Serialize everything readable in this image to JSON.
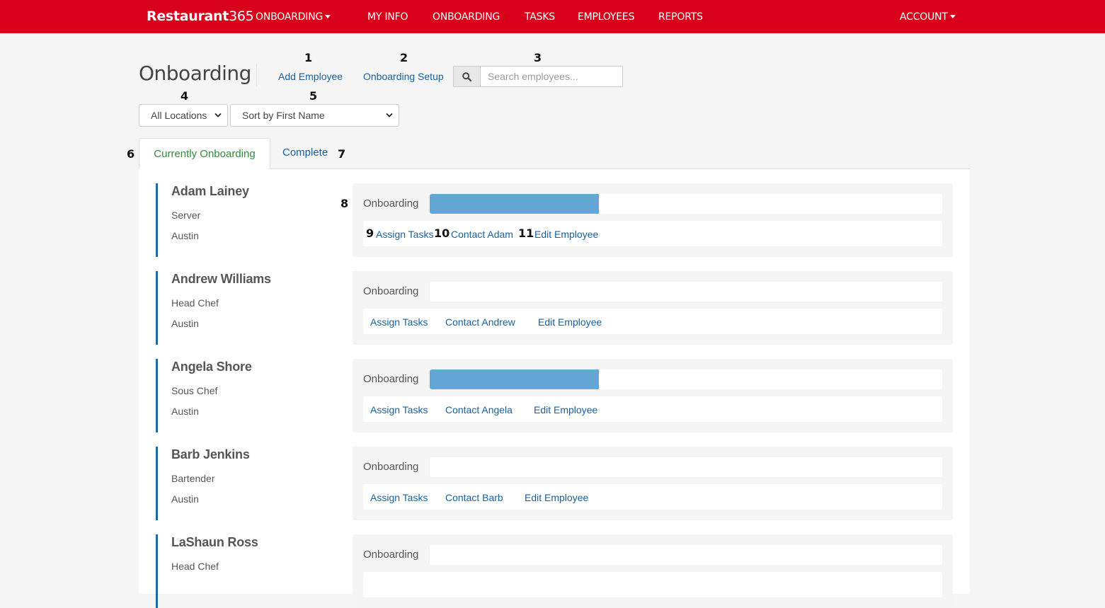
{
  "nav": {
    "brand_bold": "Restaurant",
    "brand_thin": "365",
    "module_menu": "ONBOARDING",
    "links": [
      "MY INFO",
      "ONBOARDING",
      "TASKS",
      "EMPLOYEES",
      "REPORTS"
    ],
    "account": "ACCOUNT"
  },
  "header": {
    "title": "Onboarding",
    "add_employee": "Add Employee",
    "onboarding_setup": "Onboarding Setup",
    "search_placeholder": "Search employees..."
  },
  "filters": {
    "location": "All Locations",
    "sort": "Sort by First Name"
  },
  "tabs": {
    "active": "Currently Onboarding",
    "other": "Complete"
  },
  "callouts": [
    "1",
    "2",
    "3",
    "4",
    "5",
    "6",
    "7",
    "8",
    "9",
    "10",
    "11"
  ],
  "progress_label": "Onboarding",
  "employees": [
    {
      "name": "Adam Lainey",
      "role": "Server",
      "location": "Austin",
      "progress": 0.33,
      "assign": "Assign Tasks",
      "contact": "Contact Adam",
      "edit": "Edit Employee"
    },
    {
      "name": "Andrew Williams",
      "role": "Head Chef",
      "location": "Austin",
      "progress": 0,
      "assign": "Assign Tasks",
      "contact": "Contact Andrew",
      "edit": "Edit Employee"
    },
    {
      "name": "Angela Shore",
      "role": "Sous Chef",
      "location": "Austin",
      "progress": 0.33,
      "assign": "Assign Tasks",
      "contact": "Contact Angela",
      "edit": "Edit Employee"
    },
    {
      "name": "Barb Jenkins",
      "role": "Bartender",
      "location": "Austin",
      "progress": 0,
      "assign": "Assign Tasks",
      "contact": "Contact Barb",
      "edit": "Edit Employee"
    },
    {
      "name": "LaShaun Ross",
      "role": "Head Chef",
      "location": "",
      "progress": 0,
      "assign": "",
      "contact": "",
      "edit": ""
    }
  ],
  "colors": {
    "navbar": "#d9001b",
    "link": "#1a5e9c",
    "active_tab": "#2e8b3a",
    "progress_fill": "#63a8d4",
    "employee_accent": "#1f6aa5"
  },
  "icons": {
    "search": "search-icon",
    "caret": "caret-down-icon",
    "select_chevron": "chevron-down-icon"
  }
}
